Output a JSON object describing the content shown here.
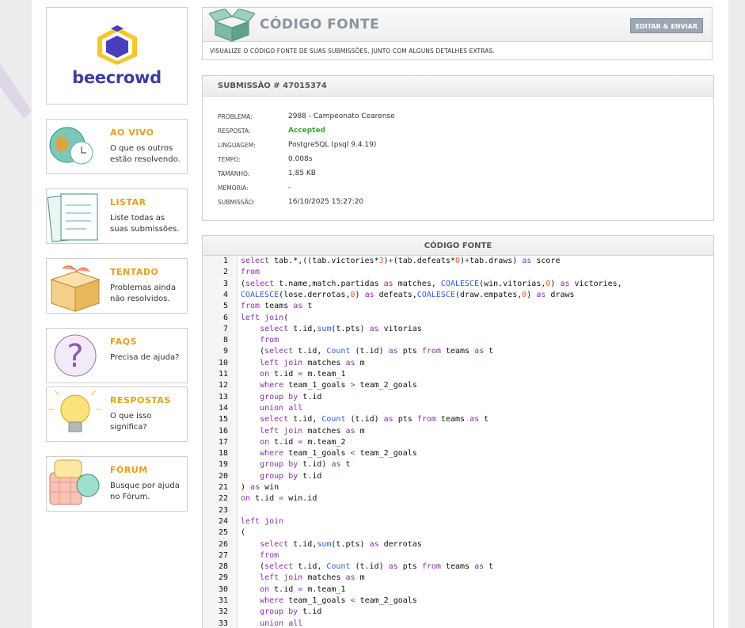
{
  "logo": {
    "brand": "beecrowd"
  },
  "sidebar": [
    {
      "id": "ao-vivo",
      "title": "AO VIVO",
      "desc": "O que os outros estão resolvendo.",
      "icon": "globe-clock-icon"
    },
    {
      "id": "listar",
      "title": "LISTAR",
      "desc": "Liste todas as suas submissões.",
      "icon": "clipboard-list-icon"
    },
    {
      "id": "tentado",
      "title": "TENTADO",
      "desc": "Problemas ainda não resolvidos.",
      "icon": "box-icon"
    },
    {
      "id": "faqs",
      "title": "FAQS",
      "desc": "Precisa de ajuda?",
      "icon": "question-mark-icon"
    },
    {
      "id": "respostas",
      "title": "RESPOSTAS",
      "desc": "O que isso significa?",
      "icon": "lightbulb-icon"
    },
    {
      "id": "forum",
      "title": "FÓRUM",
      "desc": "Busque por ajuda no Fórum.",
      "icon": "speech-bubbles-icon"
    }
  ],
  "header": {
    "title": "CÓDIGO FONTE",
    "button": "EDITAR & ENVIAR",
    "subtitle": "VISUALIZE O CÓDIGO FONTE DE SUAS SUBMISSÕES, JUNTO COM ALGUNS DETALHES EXTRAS."
  },
  "submission": {
    "heading": "SUBMISSÃO # 47015374",
    "fields": [
      {
        "label": "PROBLEMA:",
        "value": "2988 - Campeonato Cearense"
      },
      {
        "label": "RESPOSTA:",
        "value": "Accepted"
      },
      {
        "label": "LINGUAGEM:",
        "value": "PostgreSQL (psql 9.4.19)"
      },
      {
        "label": "TEMPO:",
        "value": "0.008s"
      },
      {
        "label": "TAMANHO:",
        "value": "1,85 KB"
      },
      {
        "label": "MEMÓRIA:",
        "value": "-"
      },
      {
        "label": "SUBMISSÃO:",
        "value": "16/10/2025 15:27:20"
      }
    ]
  },
  "code": {
    "heading": "CÓDIGO FONTE",
    "lines": [
      "select tab.*,((tab.victories*3)+(tab.defeats*0)+tab.draws) as score",
      "from",
      "(select t.name,match.partidas as matches, COALESCE(win.vitorias,0) as victories,",
      "COALESCE(lose.derrotas,0) as defeats,COALESCE(draw.empates,0) as draws",
      "from teams as t",
      "left join(",
      "    select t.id,sum(t.pts) as vitorias",
      "    from",
      "    (select t.id, Count (t.id) as pts from teams as t",
      "    left join matches as m",
      "    on t.id = m.team_1",
      "    where team_1_goals > team_2_goals",
      "    group by t.id",
      "    union all",
      "    select t.id, Count (t.id) as pts from teams as t",
      "    left join matches as m",
      "    on t.id = m.team_2",
      "    where team_1_goals < team_2_goals",
      "    group by t.id) as t",
      "    group by t.id",
      ") as win",
      "on t.id = win.id",
      "",
      "left join",
      "(",
      "    select t.id,sum(t.pts) as derrotas",
      "    from",
      "    (select t.id, Count (t.id) as pts from teams as t",
      "    left join matches as m",
      "    on t.id = m.team_1",
      "    where team_1_goals < team_2_goals",
      "    group by t.id",
      "    union all"
    ]
  }
}
